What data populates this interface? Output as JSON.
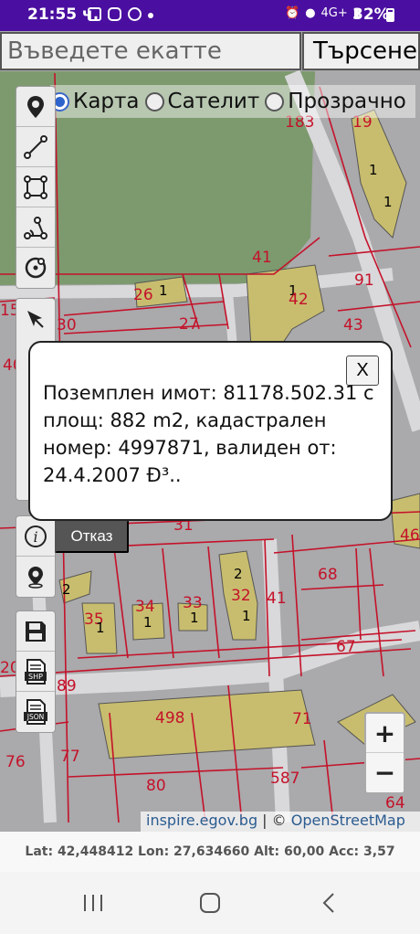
{
  "status_bar": {
    "time": "21:55 ч.",
    "network": "4G+",
    "battery": "32%",
    "icons": [
      "mail-icon",
      "instagram-icon",
      "app-icon",
      "dot-icon",
      "alarm-icon",
      "location-icon",
      "signal-icon",
      "battery-icon"
    ]
  },
  "search": {
    "placeholder": "Въведете екатте",
    "button_label": "Търсене"
  },
  "layers": {
    "options": [
      "Карта",
      "Сателит",
      "Прозрачно"
    ],
    "selected": "Карта"
  },
  "map_labels": [
    "183",
    "19",
    "1",
    "1",
    "41",
    "91",
    "26",
    "1",
    "1",
    "42",
    "27",
    "43",
    "30",
    "15",
    "40",
    "31",
    "46",
    "2",
    "34",
    "33",
    "32",
    "2",
    "68",
    "35",
    "1",
    "1",
    "1",
    "1",
    "41",
    "20",
    "89",
    "67",
    "498",
    "71",
    "76",
    "77",
    "587",
    "80",
    "64"
  ],
  "popup": {
    "close_label": "X",
    "text": "Поземплен имот: 81178.502.31 с площ: 882 m2, кадастрален номер: 4997871, валиден от: 24.4.2007 Ð³.."
  },
  "cancel_label": "Отказ",
  "toolbar": {
    "group1": [
      "marker-icon",
      "line-icon",
      "polygon-icon",
      "angle-icon",
      "circle-icon"
    ],
    "group2": [
      "pointer-icon"
    ],
    "group3": [
      "info-icon",
      "location-pin-icon"
    ],
    "group4": [
      "save-icon",
      "shp-file-icon",
      "json-file-icon"
    ]
  },
  "zoom": {
    "in": "+",
    "out": "−"
  },
  "attribution": {
    "source": "inspire.egov.bg",
    "separator": " | © ",
    "osm": "OpenStreetMap"
  },
  "coordinates": "Lat: 42,448412 Lon: 27,634660 Alt: 60,00 Acc: 3,57",
  "colors": {
    "status_bar": "#4a0fa0",
    "parcel_line": "#c4122a",
    "building": "#c8bd6e",
    "park": "#7a9c6a",
    "road": "#d7d6d8",
    "map_bg": "#aaa9ab"
  }
}
